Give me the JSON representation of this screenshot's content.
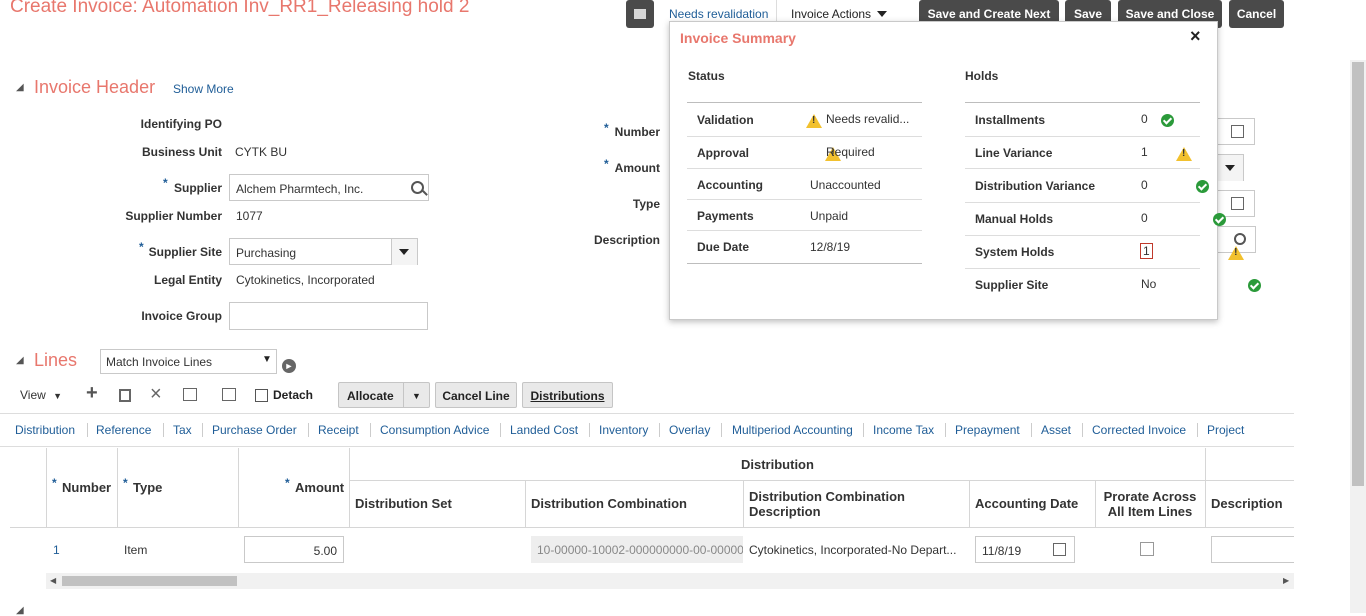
{
  "page": {
    "title": "Create Invoice: Automation Inv_RR1_Releasing hold 2"
  },
  "toolbar": {
    "needs_revalidation": "Needs revalidation",
    "invoice_actions": "Invoice Actions",
    "save_create_next": "Save and Create Next",
    "save": "Save",
    "save_close": "Save and Close",
    "cancel": "Cancel"
  },
  "header": {
    "section_title": "Invoice Header",
    "show_more": "Show More",
    "fields": {
      "identifying_po_label": "Identifying PO",
      "business_unit_label": "Business Unit",
      "business_unit_value": "CYTK BU",
      "supplier_label": "Supplier",
      "supplier_value": "Alchem Pharmtech, Inc.",
      "supplier_number_label": "Supplier Number",
      "supplier_number_value": "1077",
      "supplier_site_label": "Supplier Site",
      "supplier_site_value": "Purchasing",
      "legal_entity_label": "Legal Entity",
      "legal_entity_value": "Cytokinetics, Incorporated",
      "invoice_group_label": "Invoice Group",
      "number_label": "Number",
      "amount_label": "Amount",
      "type_label": "Type",
      "description_label": "Description"
    }
  },
  "summary": {
    "title": "Invoice Summary",
    "status_heading": "Status",
    "holds_heading": "Holds",
    "status_rows": [
      {
        "label": "Validation",
        "value": "Needs revalid...",
        "icon": "warning-icon"
      },
      {
        "label": "Approval",
        "value": "Required",
        "icon": "warning-icon"
      },
      {
        "label": "Accounting",
        "value": "Unaccounted",
        "icon": ""
      },
      {
        "label": "Payments",
        "value": "Unpaid",
        "icon": ""
      },
      {
        "label": "Due Date",
        "value": "12/8/19",
        "icon": ""
      }
    ],
    "holds_rows": [
      {
        "label": "Installments",
        "value": "0",
        "icon": "check-icon"
      },
      {
        "label": "Line Variance",
        "value": "1",
        "icon": "warning-icon"
      },
      {
        "label": "Distribution Variance",
        "value": "0",
        "icon": "check-icon"
      },
      {
        "label": "Manual Holds",
        "value": "0",
        "icon": "check-icon"
      },
      {
        "label": "System Holds",
        "value": "1",
        "icon": "warning-icon"
      },
      {
        "label": "Supplier Site",
        "value": "No",
        "icon": "check-icon"
      }
    ]
  },
  "lines": {
    "section_title": "Lines",
    "match_select": "Match Invoice Lines",
    "view_label": "View",
    "detach_label": "Detach",
    "allocate_label": "Allocate",
    "cancel_line_label": "Cancel Line",
    "distributions_label": "Distributions",
    "tabs": [
      "Distribution",
      "Reference",
      "Tax",
      "Purchase Order",
      "Receipt",
      "Consumption Advice",
      "Landed Cost",
      "Inventory",
      "Overlay",
      "Multiperiod Accounting",
      "Income Tax",
      "Prepayment",
      "Asset",
      "Corrected Invoice",
      "Project"
    ],
    "table": {
      "group_header": "Distribution",
      "columns": {
        "number": "Number",
        "type": "Type",
        "amount": "Amount",
        "distribution_set": "Distribution Set",
        "distribution_combination": "Distribution Combination",
        "distribution_combination_description": "Distribution Combination Description",
        "accounting_date": "Accounting Date",
        "prorate": "Prorate Across All Item Lines",
        "description": "Description"
      },
      "rows": [
        {
          "number": "1",
          "type": "Item",
          "amount": "5.00",
          "distribution_combination": "10-00000-10002-000000000-00-00000",
          "distribution_combination_description": "Cytokinetics, Incorporated-No Depart...",
          "accounting_date": "11/8/19"
        }
      ]
    }
  },
  "colors": {
    "accent": "#e8776d",
    "link": "#1f5d97",
    "dark_button": "#4a4a4a",
    "ok": "#2b9a3a",
    "warn": "#f2c12e"
  }
}
